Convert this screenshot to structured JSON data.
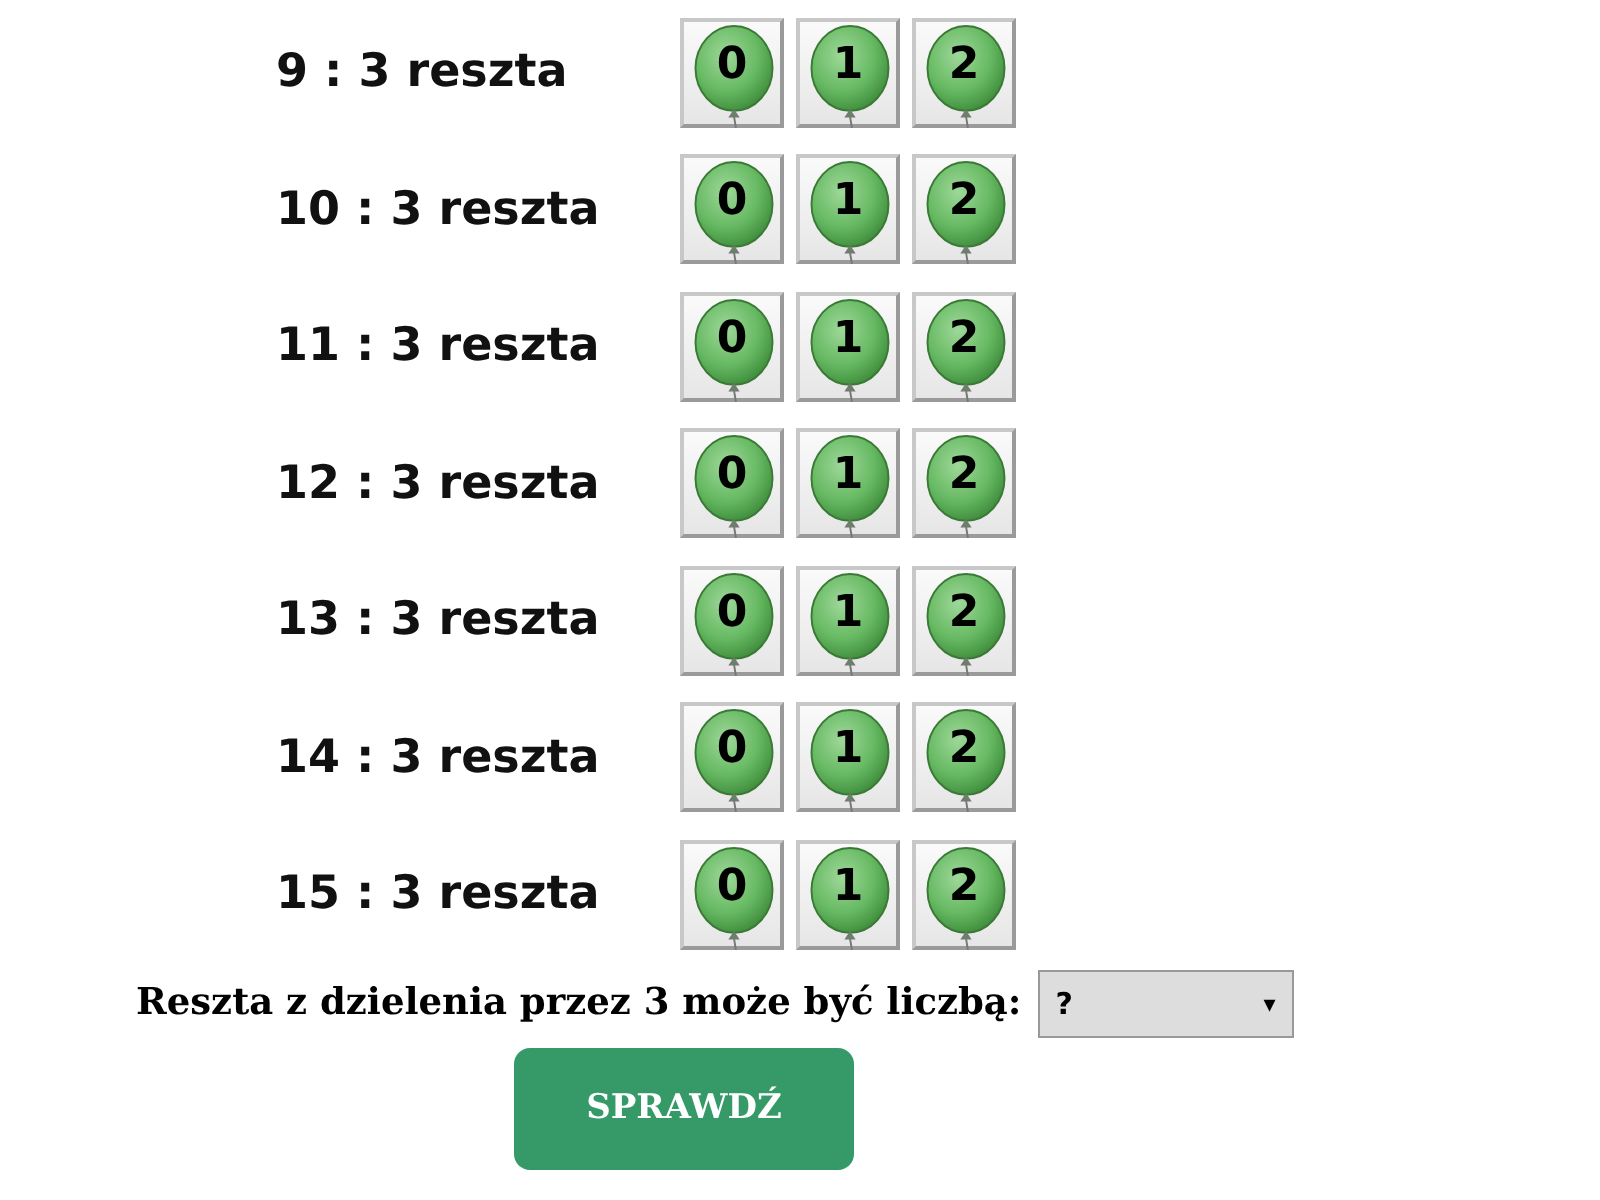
{
  "rows": [
    {
      "label": "9 : 3 reszta",
      "options": [
        "0",
        "1",
        "2"
      ]
    },
    {
      "label": "10 : 3 reszta",
      "options": [
        "0",
        "1",
        "2"
      ]
    },
    {
      "label": "11 : 3 reszta",
      "options": [
        "0",
        "1",
        "2"
      ]
    },
    {
      "label": "12 : 3 reszta",
      "options": [
        "0",
        "1",
        "2"
      ]
    },
    {
      "label": "13 : 3 reszta",
      "options": [
        "0",
        "1",
        "2"
      ]
    },
    {
      "label": "14 : 3 reszta",
      "options": [
        "0",
        "1",
        "2"
      ]
    },
    {
      "label": "15 : 3 reszta",
      "options": [
        "0",
        "1",
        "2"
      ]
    }
  ],
  "question": {
    "label": "Reszta z dzielenia przez 3 może być liczbą:",
    "dropdown_value": "?",
    "dropdown_arrow": "▾"
  },
  "check_button": "SPRAWDŹ"
}
